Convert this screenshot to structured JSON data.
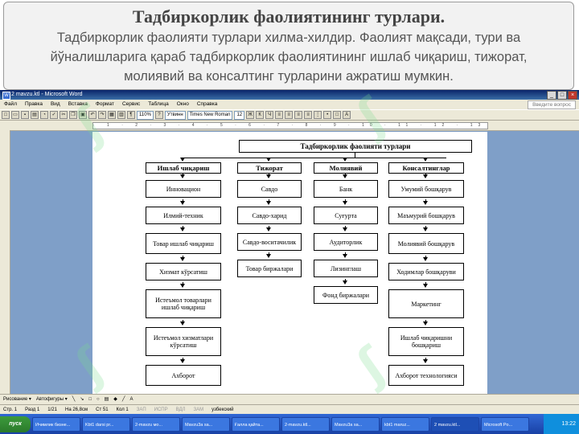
{
  "slide": {
    "title": "Тадбиркорлик фаолиятининг турлари.",
    "body": "Тадбиркорлик фаолияти турлари хилма-хилдир. Фаолият мақсади, тури ва йўналишларига қараб тадбиркорлик фаолиятининг ишлаб чиқариш, тижорат, молиявий ва консалтинг турларини ажратиш мумкин."
  },
  "window": {
    "title": "2 mavzu.ktl - Microsoft Word"
  },
  "menu": {
    "items": [
      "Файл",
      "Правка",
      "Вид",
      "Вставка",
      "Формат",
      "Сервис",
      "Таблица",
      "Окно",
      "Справка"
    ],
    "help_placeholder": "Введите вопрос"
  },
  "toolbar": {
    "zoom": "110%",
    "style": "Утвинн",
    "font": "Times New Roman",
    "size": "12"
  },
  "diagram": {
    "title": "Тадбиркорлик фаолияти турлари",
    "columns": [
      {
        "header": "Ишлаб чиқариш",
        "items": [
          "Инновацион",
          "Илмий-техник",
          "Товар ишлаб чиқариш",
          "Хизмат кўрсатиш",
          "Истеъмол товарлари ишлаб чиқариш",
          "Истеъмол хизматлари кўрсатиш",
          "Ахборот"
        ]
      },
      {
        "header": "Тижорат",
        "items": [
          "Савдо",
          "Савдо-харид",
          "Савдо-воситачилик",
          "Товар биржалари"
        ]
      },
      {
        "header": "Молиявий",
        "items": [
          "Банк",
          "Суғурта",
          "Аудиторлик",
          "Лизинглаш",
          "Фонд биржалари"
        ]
      },
      {
        "header": "Консалтинглар",
        "items": [
          "Умумий бошқарув",
          "Маъмурий бошқарув",
          "Молиявий бошқарув",
          "Ходимлар бошқаруви",
          "Маркетинг",
          "Ишлаб чиқаришни бошқариш",
          "Ахборот технологияси"
        ]
      }
    ]
  },
  "drawbar": {
    "draw": "Рисование ▾",
    "autoshapes": "Автофигуры ▾"
  },
  "status": {
    "page": "Стр. 1",
    "section": "Разд 1",
    "pages": "1/21",
    "pos": "На 26,8см",
    "line": "Ст 51",
    "col": "Кол 1",
    "rec": "ЗАП",
    "trk": "ИСПР",
    "ext": "ВДЛ",
    "ovr": "ЗАМ",
    "lang": "узбекский"
  },
  "taskbar": {
    "start": "пуск",
    "items": [
      "Ичимлик бизне...",
      "Kbt1 darsi pr...",
      "2-mavzu мо...",
      "Mavzu3a sa...",
      "Ғалла қайта...",
      "2-mavzu.ktl...",
      "Mavzu3a sa...",
      "kbt1 maruz...",
      "2 mavzu.ktl...",
      "Microsoft Po..."
    ],
    "clock": "13:22"
  }
}
